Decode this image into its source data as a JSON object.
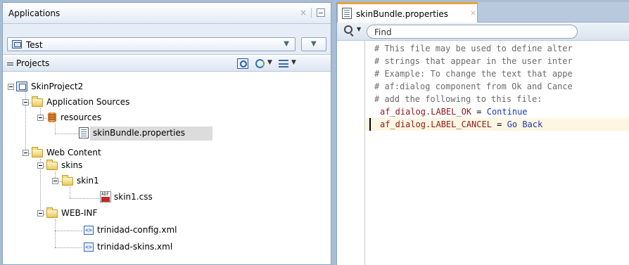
{
  "applications_panel": {
    "title": "Applications",
    "close_glyph": "×",
    "selected_app": "Test"
  },
  "projects_panel": {
    "title": "Projects",
    "tree": [
      {
        "label": "SkinProject2",
        "icon": "project-icon"
      },
      {
        "label": "Application Sources",
        "icon": "folder-icon"
      },
      {
        "label": "resources",
        "icon": "package-icon"
      },
      {
        "label": "skinBundle.properties",
        "icon": "properties-file-icon",
        "selected": true
      },
      {
        "label": "Web Content",
        "icon": "folder-icon"
      },
      {
        "label": "skins",
        "icon": "folder-icon"
      },
      {
        "label": "skin1",
        "icon": "folder-icon"
      },
      {
        "label": "skin1.css",
        "icon": "css-file-icon"
      },
      {
        "label": "WEB-INF",
        "icon": "folder-icon"
      },
      {
        "label": "trinidad-config.xml",
        "icon": "xml-file-icon"
      },
      {
        "label": "trinidad-skins.xml",
        "icon": "xml-file-icon"
      }
    ]
  },
  "editor": {
    "tab_label": "skinBundle.properties",
    "tab_close_glyph": "×",
    "find_placeholder": "Find",
    "comment_lines": [
      "# This file may be used to define alter",
      "# strings that appear in the user inter",
      "# Example: To change the text that appe",
      "# af:dialog component from Ok and Cance",
      "# add the following to this file:"
    ],
    "properties": [
      {
        "key": "af_dialog.LABEL_OK",
        "eq": " = ",
        "value": "Continue"
      },
      {
        "key": "af_dialog.LABEL_CANCEL",
        "eq": " = ",
        "value": "Go Back"
      }
    ]
  },
  "colors": {
    "tab_accent": "#e8a43a",
    "comment": "#6b6b6b",
    "property_key": "#8b1a1a",
    "property_value": "#1a3ab8",
    "selection": "#dcdcdc"
  }
}
